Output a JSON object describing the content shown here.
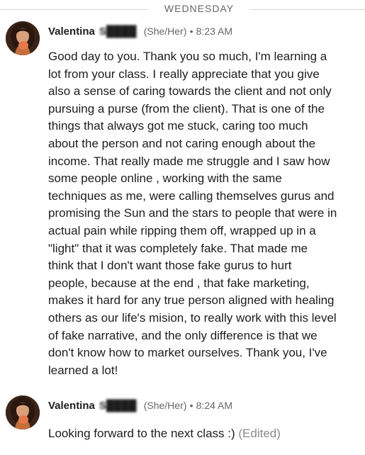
{
  "divider": {
    "label": "WEDNESDAY"
  },
  "messages": [
    {
      "sender_first": "Valentina",
      "sender_last": "S████",
      "pronouns": "(She/Her)",
      "separator": "•",
      "time": "8:23 AM",
      "avatar": "user-avatar-photo",
      "text": "Good day to you. Thank you so much, I'm learning a\nlot from your class. I really appreciate that you give\nalso a sense of caring towards the client and not only\npursuing a purse (from the client). That is one of the\nthings that always got me stuck, caring too much\nabout the person and not caring enough about the\nincome. That really made me struggle and I saw how\nsome people online , working with the same\ntechniques as me, were calling themselves gurus and\npromising the Sun and the stars to people that were in\nactual pain while ripping them off, wrapped up in a\n\"light\" that it was completely fake. That made me\nthink that I don't want those fake gurus to hurt\npeople, because at the end , that fake marketing,\nmakes it hard for any true person aligned with healing\nothers as our life's mision, to really work with this level\nof fake narrative, and the only difference is that we\ndon't know how to market ourselves. Thank you, I've\nlearned a lot!"
    },
    {
      "sender_first": "Valentina",
      "sender_last": "S████",
      "pronouns": "(She/Her)",
      "separator": "•",
      "time": "8:24 AM",
      "avatar": "user-avatar-photo",
      "text": "Looking forward to the next class :)",
      "edited": "(Edited)"
    }
  ]
}
